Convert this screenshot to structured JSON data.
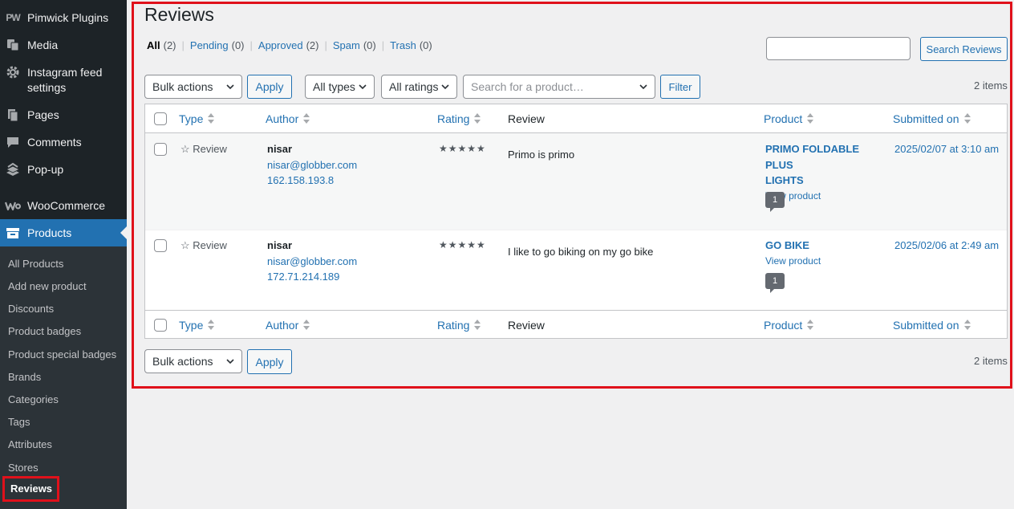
{
  "sidebar": {
    "top_items": [
      {
        "label": "Pimwick Plugins",
        "icon": "pw-logo-icon"
      },
      {
        "label": "Media",
        "icon": "media-icon"
      },
      {
        "label": "Instagram feed settings",
        "icon": "gear-icon"
      },
      {
        "label": "Pages",
        "icon": "pages-icon"
      },
      {
        "label": "Comments",
        "icon": "comments-icon"
      },
      {
        "label": "Pop-up",
        "icon": "popup-icon"
      },
      {
        "label": "WooCommerce",
        "icon": "woocommerce-icon"
      },
      {
        "label": "Products",
        "icon": "products-icon"
      }
    ],
    "submenu": [
      "All Products",
      "Add new product",
      "Discounts",
      "Product badges",
      "Product special badges",
      "Brands",
      "Categories",
      "Tags",
      "Attributes",
      "Stores",
      "Reviews"
    ],
    "current_submenu": "Reviews"
  },
  "page": {
    "title": "Reviews",
    "filters": [
      {
        "label": "All",
        "count": "(2)"
      },
      {
        "label": "Pending",
        "count": "(0)"
      },
      {
        "label": "Approved",
        "count": "(2)"
      },
      {
        "label": "Spam",
        "count": "(0)"
      },
      {
        "label": "Trash",
        "count": "(0)"
      }
    ],
    "search": {
      "value": "",
      "button": "Search Reviews"
    },
    "bulk_actions": "Bulk actions",
    "apply": "Apply",
    "type_filter": "All types",
    "rating_filter": "All ratings",
    "product_search_placeholder": "Search for a product…",
    "filter_button": "Filter",
    "items_count": "2 items"
  },
  "table": {
    "columns": {
      "type": "Type",
      "author": "Author",
      "rating": "Rating",
      "review": "Review",
      "product": "Product",
      "submitted": "Submitted on"
    },
    "rows": [
      {
        "type": "☆ Review",
        "author_name": "nisar",
        "author_email": "nisar@globber.com",
        "author_ip": "162.158.193.8",
        "rating": "★★★★★",
        "rating_value": 5,
        "review": "Primo is primo",
        "product_line1": "PRIMO FOLDABLE PLUS",
        "product_line2": "LIGHTS",
        "view_product": "View product",
        "comment_count": "1",
        "submitted": "2025/02/07 at 3:10 am"
      },
      {
        "type": "☆ Review",
        "author_name": "nisar",
        "author_email": "nisar@globber.com",
        "author_ip": "172.71.214.189",
        "rating": "★★★★★",
        "rating_value": 5,
        "review": "I like to go biking on my go bike",
        "product_line1": "GO BIKE",
        "product_line2": "",
        "view_product": "View product",
        "comment_count": "1",
        "submitted": "2025/02/06 at 2:49 am"
      }
    ]
  },
  "colors": {
    "accent": "#2271b1",
    "highlight": "#e0111b",
    "sidebar": "#1d2327"
  }
}
